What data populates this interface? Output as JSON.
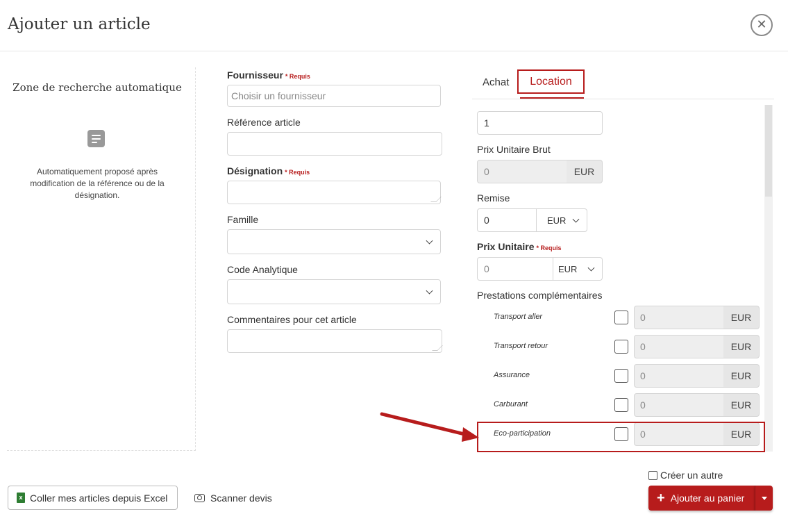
{
  "modal": {
    "title": "Ajouter un article",
    "close_symbol": "✕"
  },
  "left_panel": {
    "title": "Zone de recherche automatique",
    "icon": "document-icon",
    "text": "Automatiquement proposé après modification de la référence ou de la désignation."
  },
  "form": {
    "required_tag": "* Requis",
    "fournisseur": {
      "label": "Fournisseur",
      "placeholder": "Choisir un fournisseur",
      "required": true
    },
    "reference": {
      "label": "Référence article",
      "value": ""
    },
    "designation": {
      "label": "Désignation",
      "value": "",
      "required": true
    },
    "famille": {
      "label": "Famille",
      "value": ""
    },
    "code_analytique": {
      "label": "Code Analytique",
      "value": ""
    },
    "commentaires": {
      "label": "Commentaires pour cet article",
      "value": ""
    }
  },
  "tabs": [
    {
      "label": "Achat",
      "active": false
    },
    {
      "label": "Location",
      "active": true
    }
  ],
  "location": {
    "quantity": "1",
    "prix_unitaire_brut": {
      "label": "Prix Unitaire Brut",
      "value": "0",
      "unit": "EUR"
    },
    "remise": {
      "label": "Remise",
      "value": "0",
      "unit": "EUR"
    },
    "prix_unitaire": {
      "label": "Prix Unitaire",
      "value": "0",
      "unit": "EUR",
      "required": true
    },
    "prestations_label": "Prestations complémentaires",
    "prestations": [
      {
        "label": "Transport aller",
        "checked": false,
        "value": "0",
        "unit": "EUR"
      },
      {
        "label": "Transport retour",
        "checked": false,
        "value": "0",
        "unit": "EUR"
      },
      {
        "label": "Assurance",
        "checked": false,
        "value": "0",
        "unit": "EUR"
      },
      {
        "label": "Carburant",
        "checked": false,
        "value": "0",
        "unit": "EUR"
      },
      {
        "label": "Eco-participation",
        "checked": false,
        "value": "0",
        "unit": "EUR"
      }
    ]
  },
  "footer": {
    "excel_button": "Coller mes articles depuis Excel",
    "scan_button": "Scanner devis",
    "create_another": "Créer un autre",
    "add_button": "Ajouter au panier"
  },
  "colors": {
    "accent": "#b71c1c",
    "excel_green": "#2e7d32"
  }
}
